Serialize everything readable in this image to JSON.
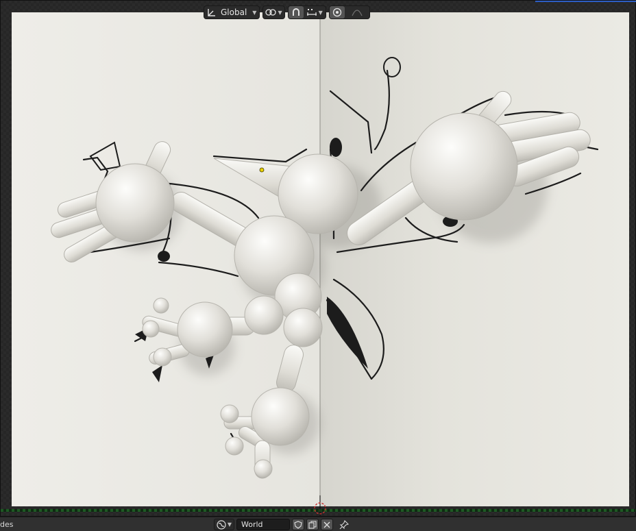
{
  "viewport": {
    "transform_orientation": "Global",
    "icons": {
      "orientation": "transform-orientation-icon",
      "pivot": "pivot-point-icon",
      "snap": "snap-icon",
      "snap_increment": "snap-increment-icon",
      "proportional": "proportional-editing-icon",
      "proportional_falloff": "falloff-icon",
      "cursor": "3d-cursor-icon"
    }
  },
  "bottom_bar": {
    "editor_label": "des",
    "world_name": "World",
    "icons": {
      "world": "world-icon",
      "fake_user": "fake-user-shield-icon",
      "duplicate": "duplicate-icon",
      "unlink": "unlink-x-icon",
      "pin": "pin-icon"
    }
  },
  "colors": {
    "accent": "#2d5ec4",
    "paper": "#eceae4",
    "frame_border": "#1d5a23",
    "selection_dot": "#e8d000"
  }
}
